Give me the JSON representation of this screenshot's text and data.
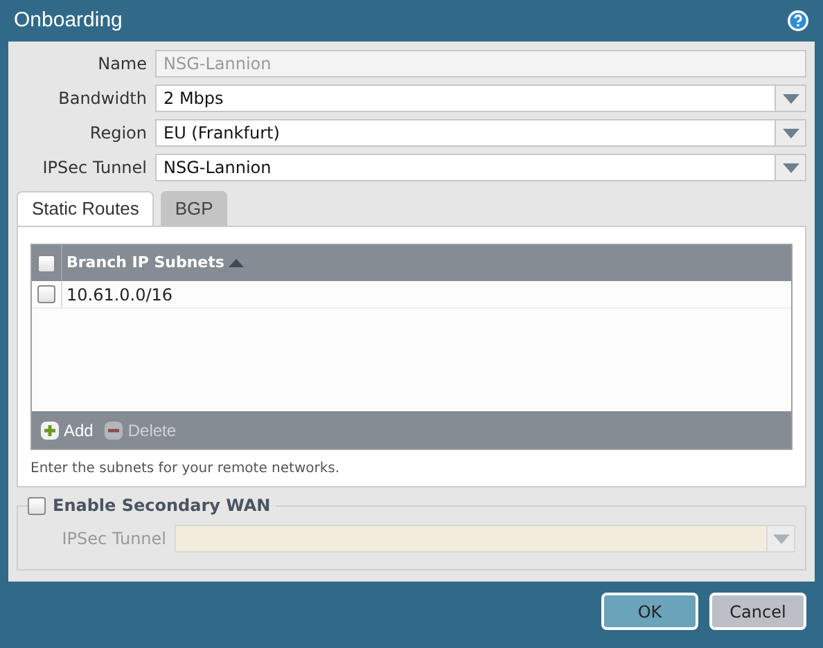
{
  "window": {
    "title": "Onboarding"
  },
  "fields": [
    {
      "label": "Name",
      "value": "NSG-Lannion",
      "kind": "text",
      "disabled": true
    },
    {
      "label": "Bandwidth",
      "value": "2 Mbps",
      "kind": "select",
      "disabled": false
    },
    {
      "label": "Region",
      "value": "EU (Frankfurt)",
      "kind": "select",
      "disabled": false
    },
    {
      "label": "IPSec Tunnel",
      "value": "NSG-Lannion",
      "kind": "select",
      "disabled": false
    }
  ],
  "tabs": [
    {
      "label": "Static Routes",
      "selected": true
    },
    {
      "label": "BGP",
      "selected": false
    }
  ],
  "table": {
    "header_checked": false,
    "columns": [
      {
        "label": "Branch IP Subnets",
        "sorted_ascending": true
      }
    ],
    "rows": [
      {
        "subnet": "10.61.0.0/16",
        "checked": false
      }
    ],
    "actions": [
      {
        "label": "Add",
        "disabled": false,
        "kind": "add"
      },
      {
        "label": "Delete",
        "disabled": true,
        "kind": "delete"
      }
    ],
    "hint": "Enter the subnets for your remote networks."
  },
  "secondary_wan": {
    "label": "Enable Secondary WAN",
    "checked": false,
    "tunnel_label": "IPSec Tunnel",
    "disabled": true
  },
  "buttons": [
    {
      "label": "OK",
      "kind": "primary"
    },
    {
      "label": "Cancel",
      "kind": "secondary"
    }
  ]
}
